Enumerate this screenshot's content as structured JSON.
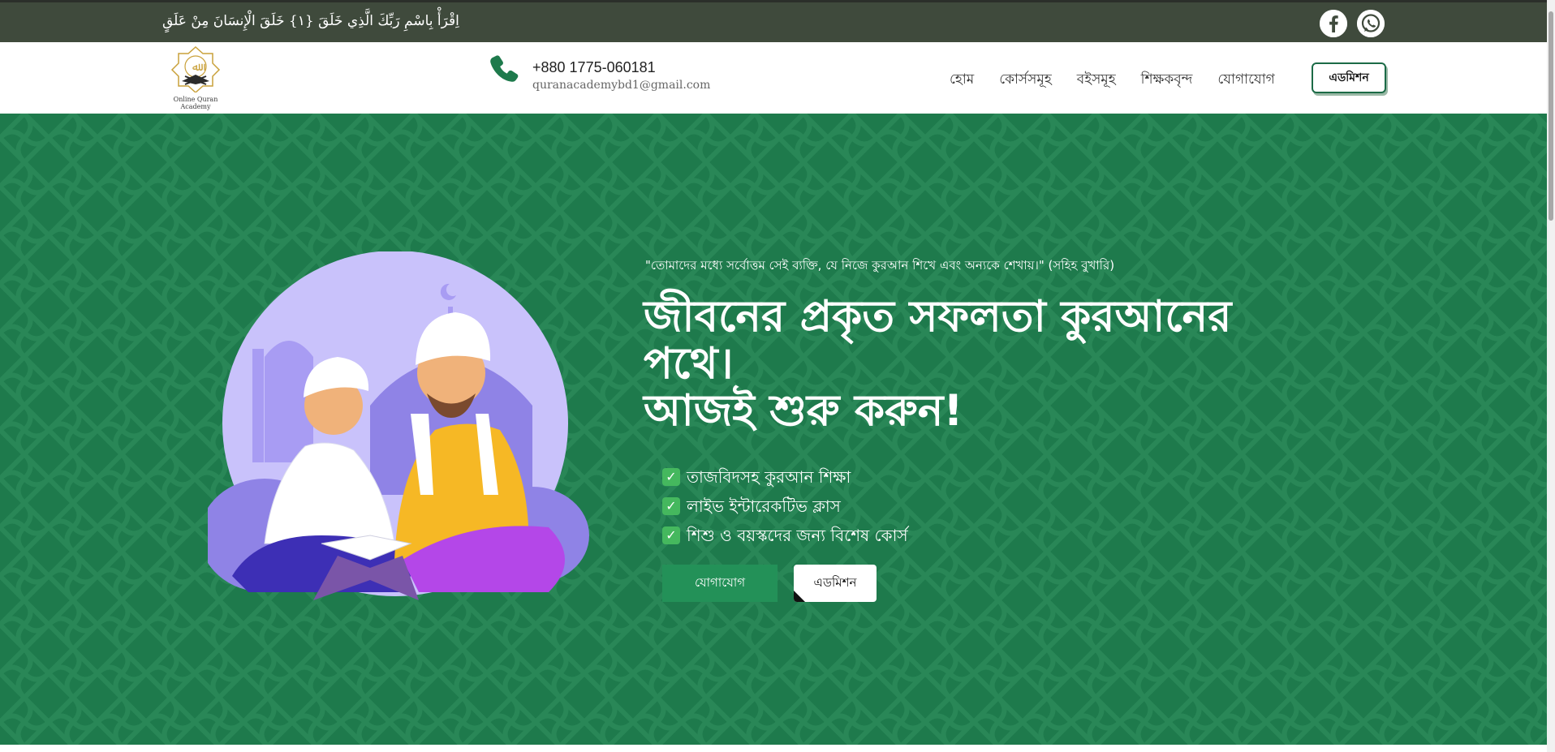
{
  "topbar": {
    "arabic_verse": "اِقْرَأْ بِاسْمِ رَبِّكَ الَّذِي خَلَقَ {١} خَلَقَ الْإِنسَانَ مِنْ عَلَقٍ",
    "social": [
      {
        "name": "facebook-icon"
      },
      {
        "name": "whatsapp-icon"
      }
    ]
  },
  "header": {
    "logo_text_line1": "Online Quran",
    "logo_text_line2": "Academy",
    "phone": "+880 1775-060181",
    "email": "quranacademybd1@gmail.com",
    "nav": [
      "হোম",
      "কোর্সসমূহ",
      "বইসমূহ",
      "শিক্ষকবৃন্দ",
      "যোগাযোগ"
    ],
    "admission_button": "এডমিশন"
  },
  "hero": {
    "quote": "\"তোমাদের মধ্যে সর্বোত্তম সেই ব্যক্তি, যে নিজে কুরআন শিখে এবং অন্যকে শেখায়।\" (সহিহ বুখারি)",
    "headline_line1": "জীবনের প্রকৃত সফলতা কুরআনের পথে।",
    "headline_line2": "আজই শুরু করুন!",
    "features": [
      "তাজবিদসহ কুরআন শিক্ষা",
      "লাইভ ইন্টারেকটিভ ক্লাস",
      "শিশু ও বয়স্কদের জন্য বিশেষ কোর্স"
    ],
    "contact_button": "যোগাযোগ",
    "admission_button": "এডমিশন"
  },
  "colors": {
    "topbar_bg": "#3f4a3c",
    "hero_bg": "#1e7a4c",
    "accent_green": "#239158",
    "circle_purple": "#c9c2fb"
  }
}
